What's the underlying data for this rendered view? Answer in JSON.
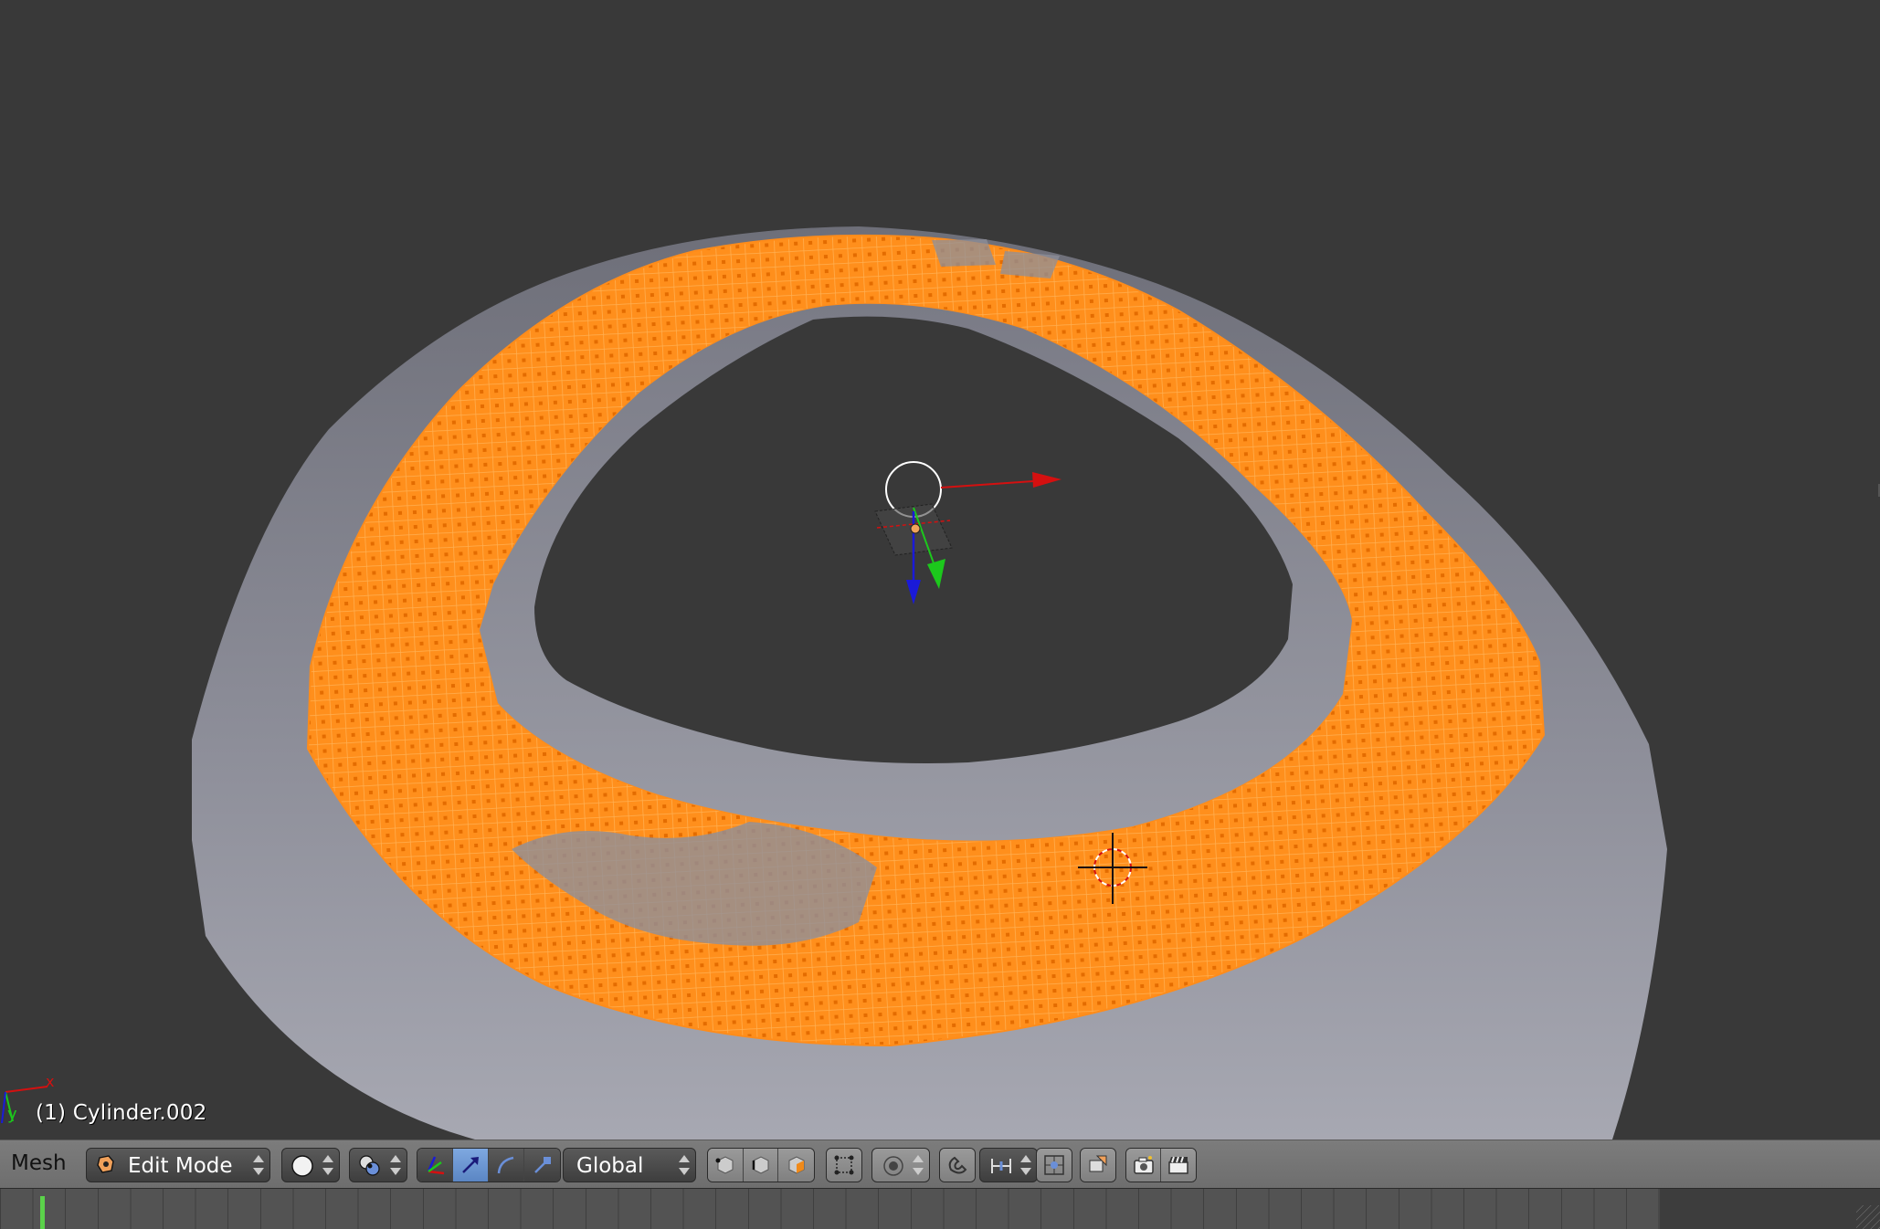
{
  "viewport": {
    "object_label": "(1) Cylinder.002",
    "axis_x_label": "x",
    "axis_y_label": "y"
  },
  "header": {
    "menu_mesh": "Mesh",
    "mode": "Edit Mode",
    "viewport_shading": "solid",
    "pivot_point": "median",
    "transform_orientation": "Global",
    "select_modes": [
      "vertex",
      "edge",
      "face"
    ],
    "manipulators": [
      "combined",
      "translate",
      "rotate",
      "scale"
    ],
    "active_manipulator": "translate"
  },
  "colors": {
    "viewport_bg": "#393939",
    "selection": "#ff8c1a",
    "mesh": "#8a8b96",
    "axis_x": "#d41010",
    "axis_y": "#1cc81c",
    "axis_z": "#1a1ad8",
    "timeline_cursor": "#5bd24a"
  },
  "icons": {
    "mode_icon": "edit-mode-icon",
    "shading_icon": "solid-sphere-icon",
    "pivot_icon": "pivot-point-icon"
  }
}
